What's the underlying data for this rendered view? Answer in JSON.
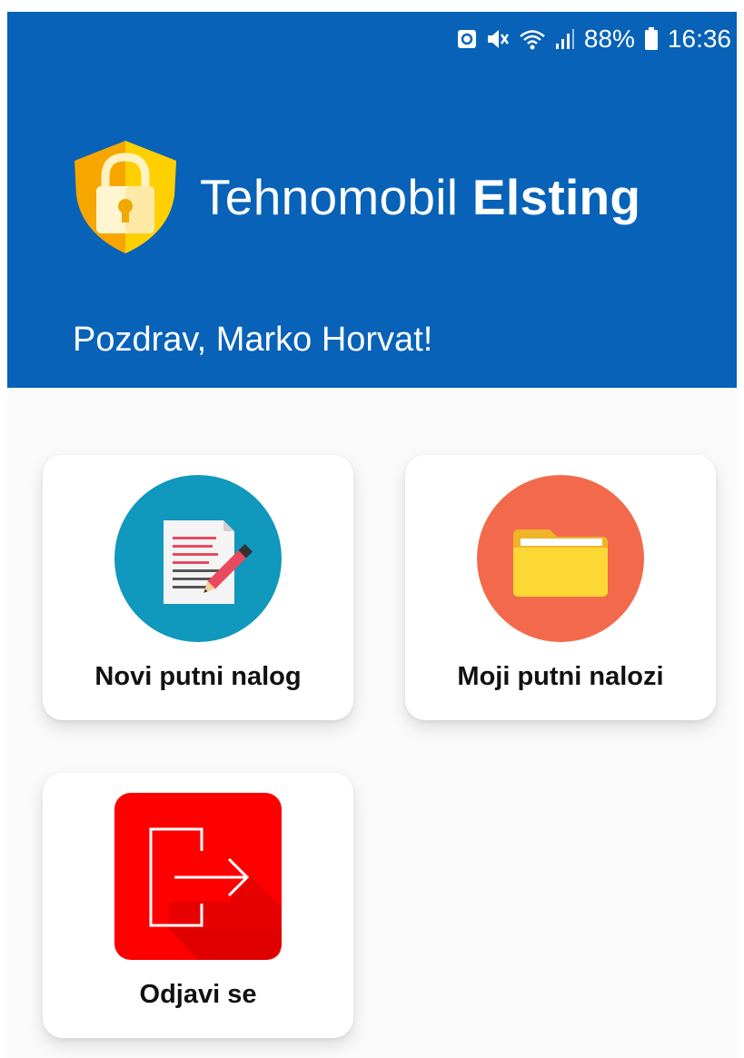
{
  "status_bar": {
    "battery_percent": "88%",
    "time": "16:36",
    "icons": [
      "nfc-icon",
      "mute-icon",
      "wifi-icon",
      "signal-icon",
      "battery-icon"
    ]
  },
  "header": {
    "brand_light": "Tehnomobil",
    "brand_bold": "Elsting",
    "greeting": "Pozdrav, Marko Horvat!"
  },
  "menu": {
    "tiles": [
      {
        "label": "Novi putni nalog",
        "icon": "document-edit-icon"
      },
      {
        "label": "Moji putni nalozi",
        "icon": "folder-icon"
      },
      {
        "label": "Odjavi se",
        "icon": "logout-icon"
      }
    ]
  },
  "colors": {
    "header_bg": "#0762b8",
    "tile_new_circle": "#1098bd",
    "tile_mine_circle": "#f26a4b",
    "folder": "#fdd835",
    "logout_bg": "#ff0000"
  }
}
